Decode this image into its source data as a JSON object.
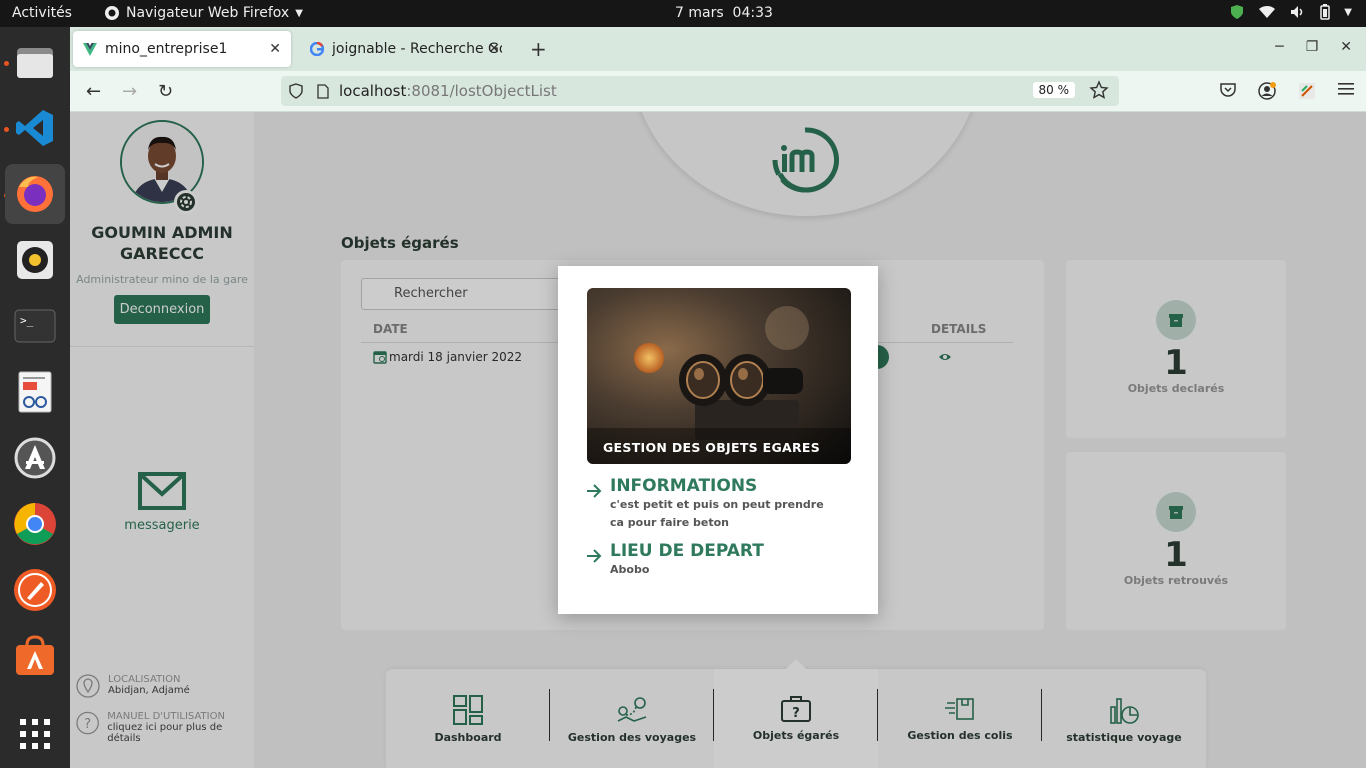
{
  "topbar": {
    "activities": "Activités",
    "app_name": "Navigateur Web Firefox",
    "date": "7 mars",
    "time": "04:33"
  },
  "dock": {
    "apps": [
      "files-icon",
      "vscode-icon",
      "firefox-icon",
      "rhythmbox-icon",
      "terminal-icon",
      "document-viewer-icon",
      "software-updater-icon",
      "chrome-icon",
      "postman-icon",
      "app-center-icon",
      "show-apps-icon"
    ]
  },
  "browser": {
    "tabs": [
      {
        "title": "mino_entreprise1",
        "favicon": "vue-icon"
      },
      {
        "title": "joignable - Recherche Go",
        "favicon": "google-icon"
      }
    ],
    "url_host": "localhost",
    "url_path": ":8081/lostObjectList",
    "zoom": "80 %"
  },
  "sidebar": {
    "user_name": "GOUMIN ADMIN GARECCC",
    "role": "Administrateur mino de la gare",
    "logout": "Deconnexion",
    "messaging": "messagerie",
    "location_label": "LOCALISATION",
    "location_value": "Abidjan, Adjamé",
    "manual_label": "MANUEL D'UTILISATION",
    "manual_value": "cliquez ici pour plus de détails"
  },
  "main": {
    "section_title": "Objets égarés",
    "search_placeholder": "Rechercher",
    "col_date": "DATE",
    "col_details": "DETAILS",
    "rows": [
      {
        "date": "mardi 18 janvier 2022"
      }
    ]
  },
  "stats": [
    {
      "value": "1",
      "label": "Objets declarés"
    },
    {
      "value": "1",
      "label": "Objets retrouvés"
    }
  ],
  "bottom_nav": [
    {
      "label": "Dashboard"
    },
    {
      "label": "Gestion des voyages"
    },
    {
      "label": "Objets égarés"
    },
    {
      "label": "Gestion des colis"
    },
    {
      "label": "statistique voyage"
    }
  ],
  "modal": {
    "image_caption": "GESTION DES OBJETS EGARES",
    "info_title": "INFORMATIONS",
    "info_text": "c'est petit et puis on peut prendre ca pour faire beton",
    "departure_title": "LIEU DE DEPART",
    "departure_text": "Abobo"
  },
  "colors": {
    "accent": "#2f7a5c",
    "tabbar": "#d9e8df"
  }
}
